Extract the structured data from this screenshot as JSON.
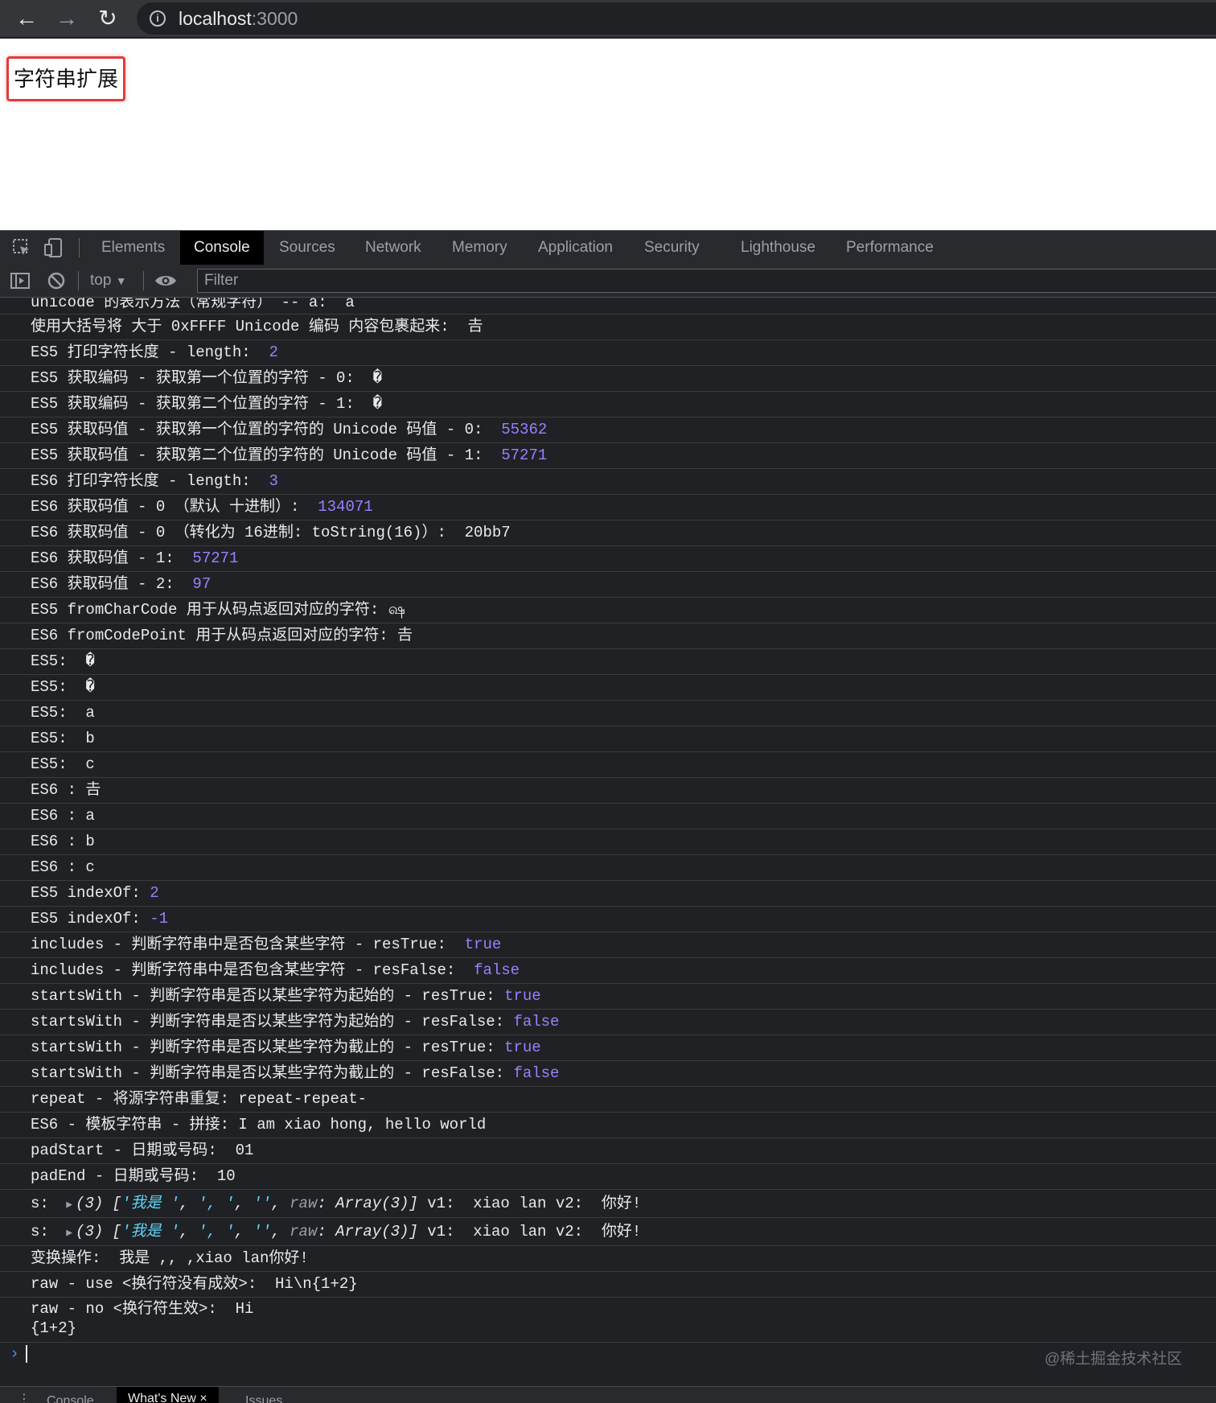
{
  "browser": {
    "url_host": "localhost",
    "url_port": ":3000"
  },
  "page": {
    "heading": "字符串扩展"
  },
  "devtools": {
    "tabs": [
      "Elements",
      "Console",
      "Sources",
      "Network",
      "Memory",
      "Application",
      "Security",
      "Lighthouse",
      "Performance"
    ],
    "active_tab": "Console",
    "context": "top",
    "filter_placeholder": "Filter"
  },
  "console": {
    "cut_line": "unicode 的表示方法（常规字符） -- a:  a",
    "lines": [
      {
        "text": "使用大括号将 大于 0xFFFF Unicode 编码 内容包裹起来:  ",
        "value": "𠮷",
        "vtype": "plain"
      },
      {
        "text": "ES5 打印字符长度 - length:  ",
        "value": "2",
        "vtype": "num"
      },
      {
        "text": "ES5 获取编码 - 获取第一个位置的字符 - 0:  ",
        "value": "�",
        "vtype": "plain"
      },
      {
        "text": "ES5 获取编码 - 获取第二个位置的字符 - 1:  ",
        "value": "�",
        "vtype": "plain"
      },
      {
        "text": "ES5 获取码值 - 获取第一个位置的字符的 Unicode 码值 - 0:  ",
        "value": "55362",
        "vtype": "num"
      },
      {
        "text": "ES5 获取码值 - 获取第二个位置的字符的 Unicode 码值 - 1:  ",
        "value": "57271",
        "vtype": "num"
      },
      {
        "text": "ES6 打印字符长度 - length:  ",
        "value": "3",
        "vtype": "num"
      },
      {
        "text": "ES6 获取码值 - 0 （默认 十进制）:  ",
        "value": "134071",
        "vtype": "num"
      },
      {
        "text": "ES6 获取码值 - 0 （转化为 16进制: toString(16)）:  ",
        "value": "20bb7",
        "vtype": "plain"
      },
      {
        "text": "ES6 获取码值 - 1:  ",
        "value": "57271",
        "vtype": "num"
      },
      {
        "text": "ES6 获取码值 - 2:  ",
        "value": "97",
        "vtype": "num"
      },
      {
        "text": "ES5 fromCharCode 用于从码点返回对应的字符: ",
        "value": "ஷ",
        "vtype": "plain"
      },
      {
        "text": "ES6 fromCodePoint 用于从码点返回对应的字符: ",
        "value": "𠮷",
        "vtype": "plain"
      },
      {
        "text": "ES5:  ",
        "value": "�",
        "vtype": "plain"
      },
      {
        "text": "ES5:  ",
        "value": "�",
        "vtype": "plain"
      },
      {
        "text": "ES5:  ",
        "value": "a",
        "vtype": "plain"
      },
      {
        "text": "ES5:  ",
        "value": "b",
        "vtype": "plain"
      },
      {
        "text": "ES5:  ",
        "value": "c",
        "vtype": "plain"
      },
      {
        "text": "ES6 : ",
        "value": "𠮷",
        "vtype": "plain"
      },
      {
        "text": "ES6 : ",
        "value": "a",
        "vtype": "plain"
      },
      {
        "text": "ES6 : ",
        "value": "b",
        "vtype": "plain"
      },
      {
        "text": "ES6 : ",
        "value": "c",
        "vtype": "plain"
      },
      {
        "text": "ES5 indexOf: ",
        "value": "2",
        "vtype": "num"
      },
      {
        "text": "ES5 indexOf: ",
        "value": "-1",
        "vtype": "num"
      },
      {
        "text": "includes - 判断字符串中是否包含某些字符 - resTrue:  ",
        "value": "true",
        "vtype": "bool"
      },
      {
        "text": "includes - 判断字符串中是否包含某些字符 - resFalse:  ",
        "value": "false",
        "vtype": "bool"
      },
      {
        "text": "startsWith - 判断字符串是否以某些字符为起始的 - resTrue: ",
        "value": "true",
        "vtype": "bool"
      },
      {
        "text": "startsWith - 判断字符串是否以某些字符为起始的 - resFalse: ",
        "value": "false",
        "vtype": "bool"
      },
      {
        "text": "startsWith - 判断字符串是否以某些字符为截止的 - resTrue: ",
        "value": "true",
        "vtype": "bool"
      },
      {
        "text": "startsWith - 判断字符串是否以某些字符为截止的 - resFalse: ",
        "value": "false",
        "vtype": "bool"
      },
      {
        "text": "repeat - 将源字符串重复: ",
        "value": "repeat-repeat-",
        "vtype": "plain"
      },
      {
        "text": "ES6 - 模板字符串 - 拼接: ",
        "value": "I am xiao hong, hello world",
        "vtype": "plain"
      },
      {
        "text": "padStart - 日期或号码:  ",
        "value": "01",
        "vtype": "plain"
      },
      {
        "text": "padEnd - 日期或号码:  ",
        "value": "10",
        "vtype": "plain"
      }
    ],
    "object_lines": [
      {
        "label": "s: ",
        "count": "(3)",
        "open": "[",
        "s1": "'我是 '",
        "c1": ", ",
        "s2": "', '",
        "c2": ", ",
        "s3": "''",
        "c3": ", ",
        "rawkey": "raw",
        "rawval": ": Array(3)",
        "close": "]",
        "rest": " v1:  xiao lan v2:  你好!"
      },
      {
        "label": "s: ",
        "count": "(3)",
        "open": "[",
        "s1": "'我是 '",
        "c1": ", ",
        "s2": "', '",
        "c2": ", ",
        "s3": "''",
        "c3": ", ",
        "rawkey": "raw",
        "rawval": ": Array(3)",
        "close": "]",
        "rest": " v1:  xiao lan v2:  你好!"
      }
    ],
    "tail_lines": [
      "变换操作:  我是 ,, ,xiao lan你好!",
      "raw - use <换行符没有成效>:  Hi\\n{1+2}"
    ],
    "raw_no": {
      "line1": "raw - no <换行符生效>:  Hi",
      "line2": "{1+2}"
    },
    "prompt": "›"
  },
  "watermark": "@稀土掘金技术社区",
  "drawer": {
    "tabs": [
      "Console",
      "What's New",
      "Issues"
    ],
    "active": "What's New",
    "close": "×"
  }
}
